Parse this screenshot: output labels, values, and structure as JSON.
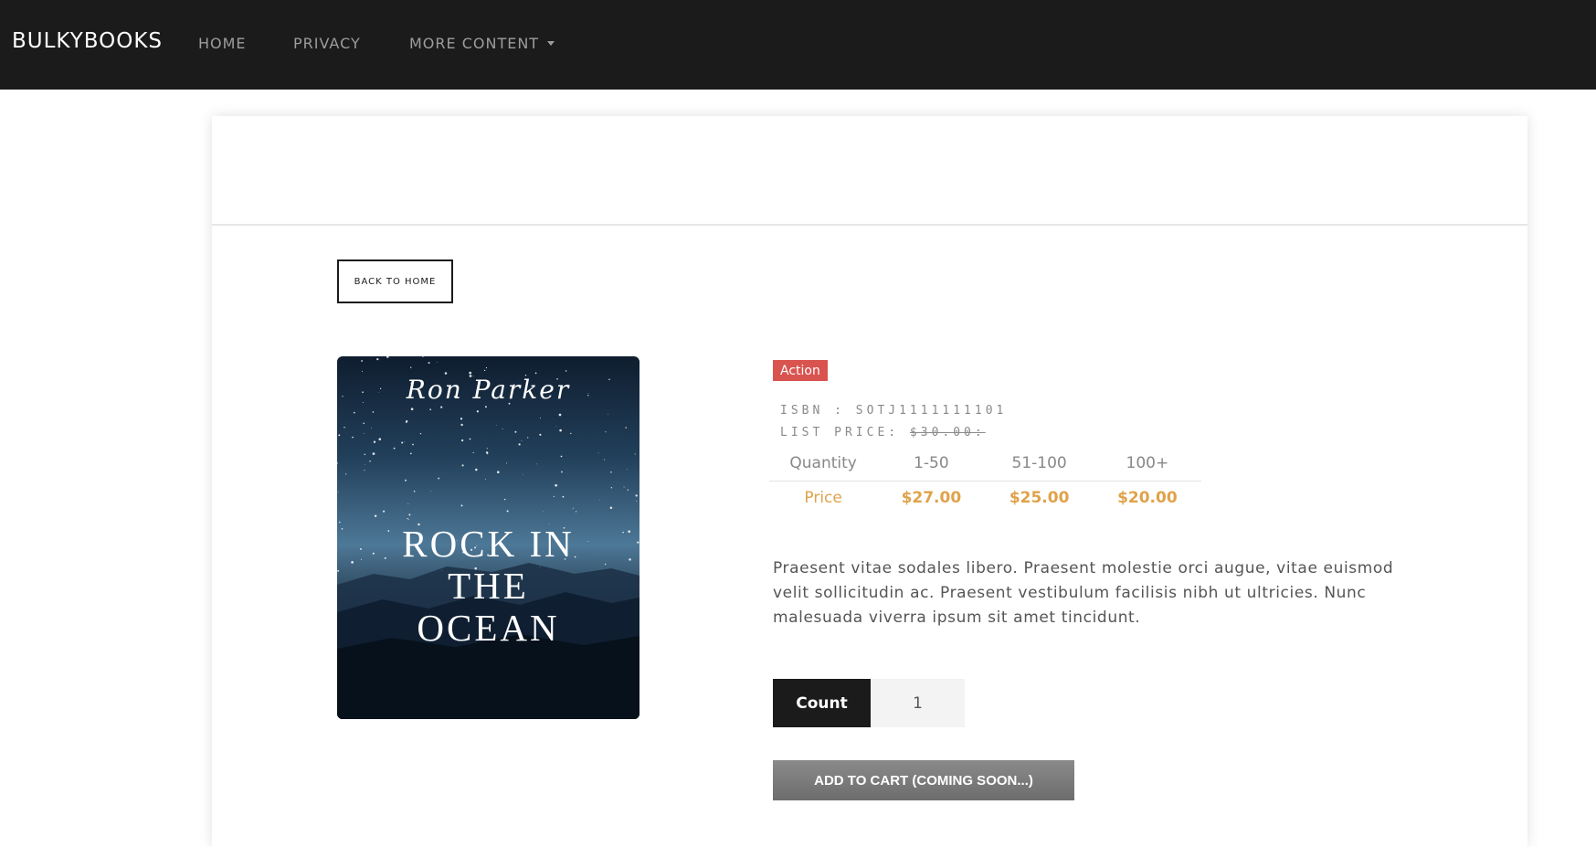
{
  "navbar": {
    "brand": "BULKYBOOKS",
    "links": [
      {
        "label": "HOME"
      },
      {
        "label": "PRIVACY"
      },
      {
        "label": "MORE CONTENT"
      }
    ]
  },
  "product": {
    "back_label": "BACK TO HOME",
    "cover": {
      "author": "Ron Parker",
      "title_lines": [
        "ROCK IN",
        "THE",
        "OCEAN"
      ]
    },
    "category_badge": "Action",
    "isbn_line": "ISBN : SOTJ1111111101",
    "list_price_label": "LIST PRICE: ",
    "list_price_value": "$30.00:",
    "price_table": {
      "header": [
        "Quantity",
        "1-50",
        "51-100",
        "100+"
      ],
      "row": [
        "Price",
        "$27.00",
        "$25.00",
        "$20.00"
      ]
    },
    "description": "Praesent vitae sodales libero. Praesent molestie orci augue, vitae euismod velit sollicitudin ac. Praesent vestibulum facilisis nibh ut ultricies. Nunc malesuada viverra ipsum sit amet tincidunt.",
    "count_label": "Count",
    "count_value": "1",
    "add_to_cart_label": "ADD TO CART (COMING SOON...)"
  },
  "colors": {
    "navbar_bg": "#1b1b1b",
    "badge": "#d9534f",
    "price_accent": "#e0a24a",
    "button_gray": "#7a7a7a"
  }
}
